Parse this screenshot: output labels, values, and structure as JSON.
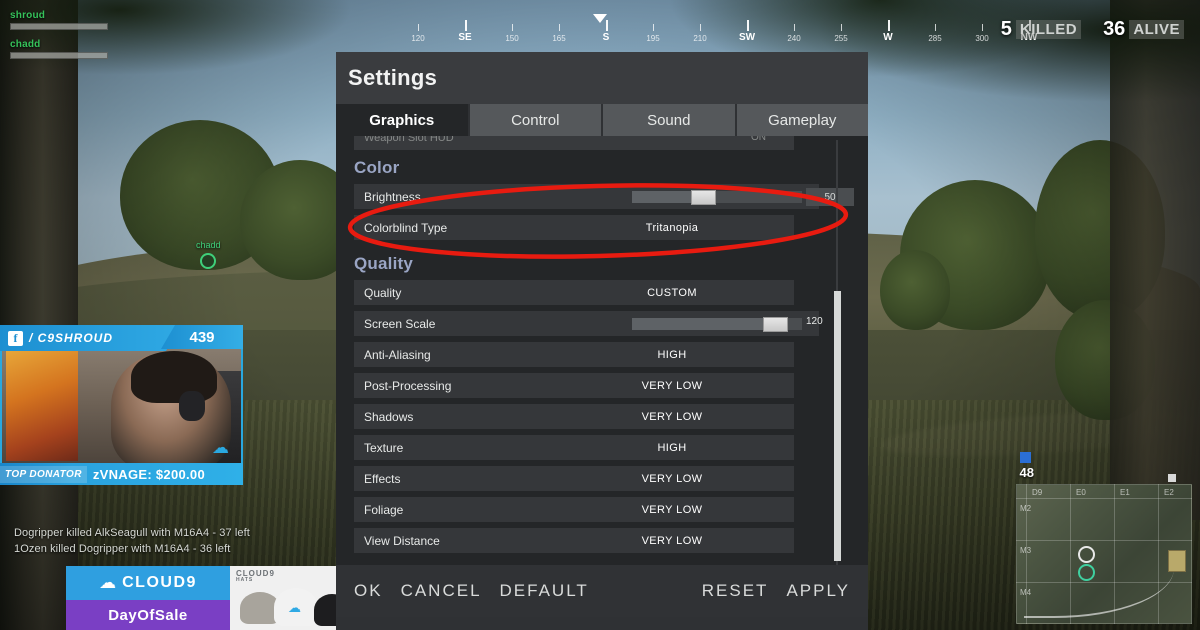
{
  "game": {
    "team": [
      {
        "name": "shroud",
        "health": 100
      },
      {
        "name": "chadd",
        "health": 100
      }
    ],
    "status": {
      "killed_count": "5",
      "killed_label": "KILLED",
      "alive_count": "36",
      "alive_label": "ALIVE"
    },
    "compass": {
      "ticks": [
        {
          "label": "120",
          "cardinal": false
        },
        {
          "label": "SE",
          "cardinal": true
        },
        {
          "label": "150",
          "cardinal": false
        },
        {
          "label": "165",
          "cardinal": false
        },
        {
          "label": "S",
          "cardinal": true
        },
        {
          "label": "195",
          "cardinal": false
        },
        {
          "label": "210",
          "cardinal": false
        },
        {
          "label": "SW",
          "cardinal": true
        },
        {
          "label": "240",
          "cardinal": false
        },
        {
          "label": "255",
          "cardinal": false
        },
        {
          "label": "W",
          "cardinal": true
        },
        {
          "label": "285",
          "cardinal": false
        },
        {
          "label": "300",
          "cardinal": false
        },
        {
          "label": "NW",
          "cardinal": true
        }
      ]
    },
    "world_marker": {
      "name": "chadd"
    },
    "kill_feed": [
      "Dogripper killed AlkSeagull with M16A4 - 37 left",
      "1Ozen killed Dogripper with M16A4 - 36 left"
    ],
    "minimap": {
      "player_count": "48",
      "col_labels": [
        "D9",
        "E0",
        "E1",
        "E2"
      ],
      "row_labels": [
        "M2",
        "M3",
        "M4"
      ]
    }
  },
  "stream_overlay": {
    "platform_icon": "facebook-icon",
    "channel_handle": "/ C9SHROUD",
    "viewer_count": "439",
    "donator_label": "TOP DONATOR",
    "donator_value": "zVNAGE: $200.00"
  },
  "ad_banner": {
    "brand_mark": "cloud9-icon",
    "brand_name": "CLOUD9",
    "purple_text": "DayOfSale",
    "product_title": "CLOUD9",
    "product_sub": "HATS"
  },
  "settings": {
    "title": "Settings",
    "tabs": [
      {
        "label": "Graphics",
        "active": true
      },
      {
        "label": "Control",
        "active": false
      },
      {
        "label": "Sound",
        "active": false
      },
      {
        "label": "Gameplay",
        "active": false
      }
    ],
    "cut_row": {
      "label": "Weapon Slot HUD",
      "value": "ON"
    },
    "sections": [
      {
        "heading": "Color",
        "rows": [
          {
            "label": "Brightness",
            "type": "slider",
            "value": "50",
            "percent": 42
          },
          {
            "label": "Colorblind Type",
            "type": "value",
            "value": "Tritanopia"
          }
        ]
      },
      {
        "heading": "Quality",
        "rows": [
          {
            "label": "Quality",
            "type": "value",
            "value": "CUSTOM"
          },
          {
            "label": "Screen Scale",
            "type": "scale",
            "value": "120",
            "percent": 84
          },
          {
            "label": "Anti-Aliasing",
            "type": "value",
            "value": "HIGH"
          },
          {
            "label": "Post-Processing",
            "type": "value",
            "value": "VERY LOW"
          },
          {
            "label": "Shadows",
            "type": "value",
            "value": "VERY LOW"
          },
          {
            "label": "Texture",
            "type": "value",
            "value": "HIGH"
          },
          {
            "label": "Effects",
            "type": "value",
            "value": "VERY LOW"
          },
          {
            "label": "Foliage",
            "type": "value",
            "value": "VERY LOW"
          },
          {
            "label": "View Distance",
            "type": "value",
            "value": "VERY LOW"
          }
        ]
      }
    ],
    "buttons_left": [
      "OK",
      "CANCEL",
      "DEFAULT"
    ],
    "buttons_right": [
      "RESET",
      "APPLY"
    ]
  },
  "annotation": {
    "color": "#e81b10",
    "shape": "ellipse",
    "targets": [
      "Brightness",
      "Colorblind Type"
    ]
  },
  "colors": {
    "accent_blue": "#2fa9e4",
    "section_heading": "#9aa5c4",
    "team_green": "#35c25a",
    "annotation_red": "#e81b10",
    "panel_bg": "#242628",
    "row_bg": "#35373a"
  }
}
